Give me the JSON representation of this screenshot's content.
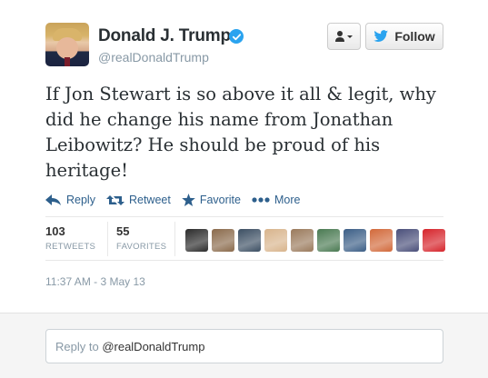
{
  "user": {
    "name": "Donald J. Trump",
    "handle": "@realDonaldTrump",
    "verified": true
  },
  "buttons": {
    "follow_label": "Follow"
  },
  "tweet": {
    "text": "If Jon Stewart is so above it all & legit, why did he change his name from Jonathan Leibowitz? He should be proud of his heritage!"
  },
  "actions": {
    "reply": "Reply",
    "retweet": "Retweet",
    "favorite": "Favorite",
    "more": "More"
  },
  "stats": {
    "retweets_count": "103",
    "retweets_label": "RETWEETS",
    "favorites_count": "55",
    "favorites_label": "FAVORITES"
  },
  "favoriters": [
    {
      "color": "#2b2b2b"
    },
    {
      "color": "#8a6a4b"
    },
    {
      "color": "#3c4f63"
    },
    {
      "color": "#d8b48c"
    },
    {
      "color": "#9a7a5c"
    },
    {
      "color": "#4a7a52"
    },
    {
      "color": "#3b5e86"
    },
    {
      "color": "#d2693a"
    },
    {
      "color": "#4a4f7a"
    },
    {
      "color": "#d6242b"
    }
  ],
  "timestamp": "11:37 AM - 3 May 13",
  "reply": {
    "prefix": "Reply to ",
    "mention": "@realDonaldTrump"
  },
  "colors": {
    "accent": "#2d5f8c",
    "verified_badge": "#2aa3ef",
    "muted": "#8899a6"
  }
}
